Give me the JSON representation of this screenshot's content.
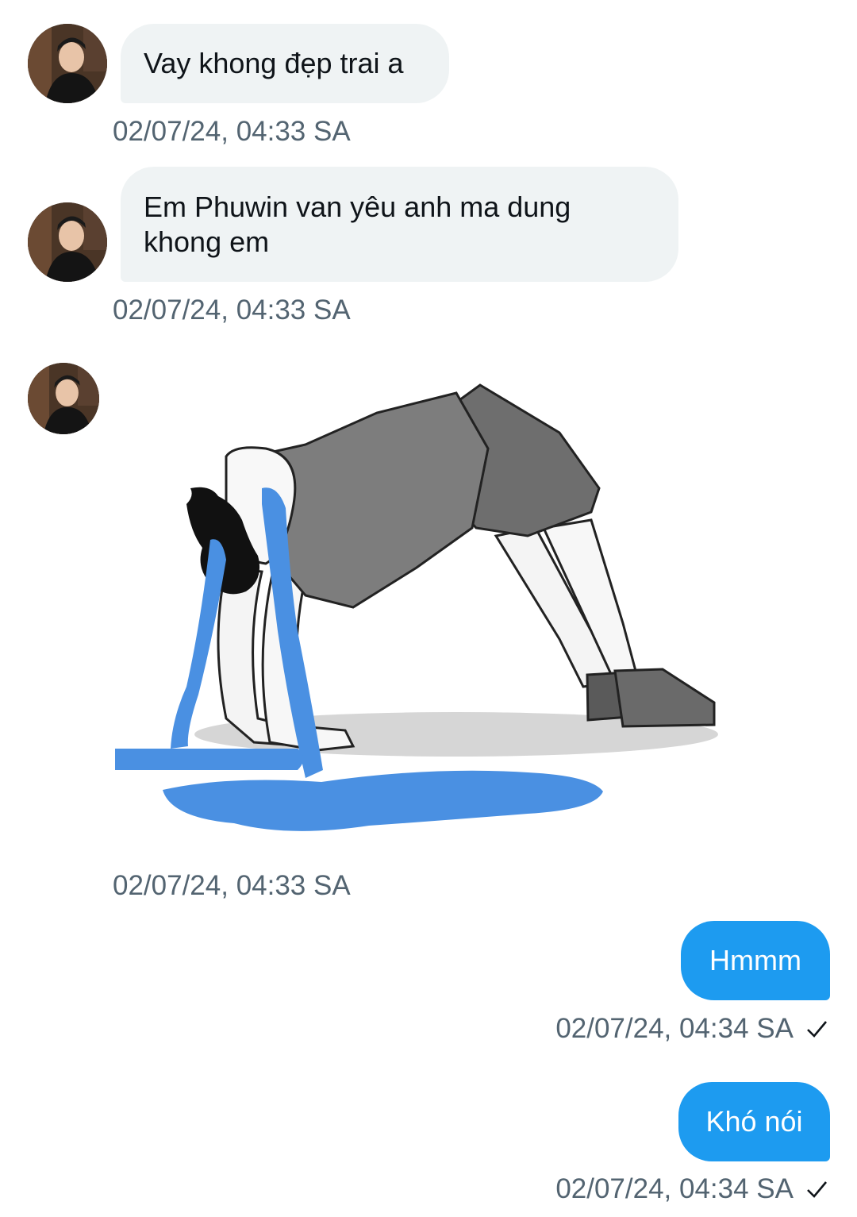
{
  "conversation": {
    "messages": [
      {
        "direction": "incoming",
        "type": "text",
        "text": "Vay khong đẹp trai a",
        "timestamp": "02/07/24, 04:33 SA"
      },
      {
        "direction": "incoming",
        "type": "text",
        "text": "Em Phuwin van yêu anh ma dung khong em",
        "timestamp": "02/07/24, 04:33 SA"
      },
      {
        "direction": "incoming",
        "type": "image",
        "image_description": "cartoon-crying-backbend-meme",
        "timestamp": "02/07/24, 04:33 SA"
      },
      {
        "direction": "outgoing",
        "type": "text",
        "text": "Hmmm",
        "timestamp": "02/07/24, 04:34 SA",
        "status_icon": "check-icon"
      },
      {
        "direction": "outgoing",
        "type": "text",
        "text": "Khó nói",
        "timestamp": "02/07/24, 04:34 SA",
        "status_icon": "check-icon"
      }
    ]
  },
  "colors": {
    "incoming_bubble": "#eff3f4",
    "outgoing_bubble": "#1d9bf0",
    "timestamp_text": "#536471",
    "tears": "#4a90e2"
  }
}
